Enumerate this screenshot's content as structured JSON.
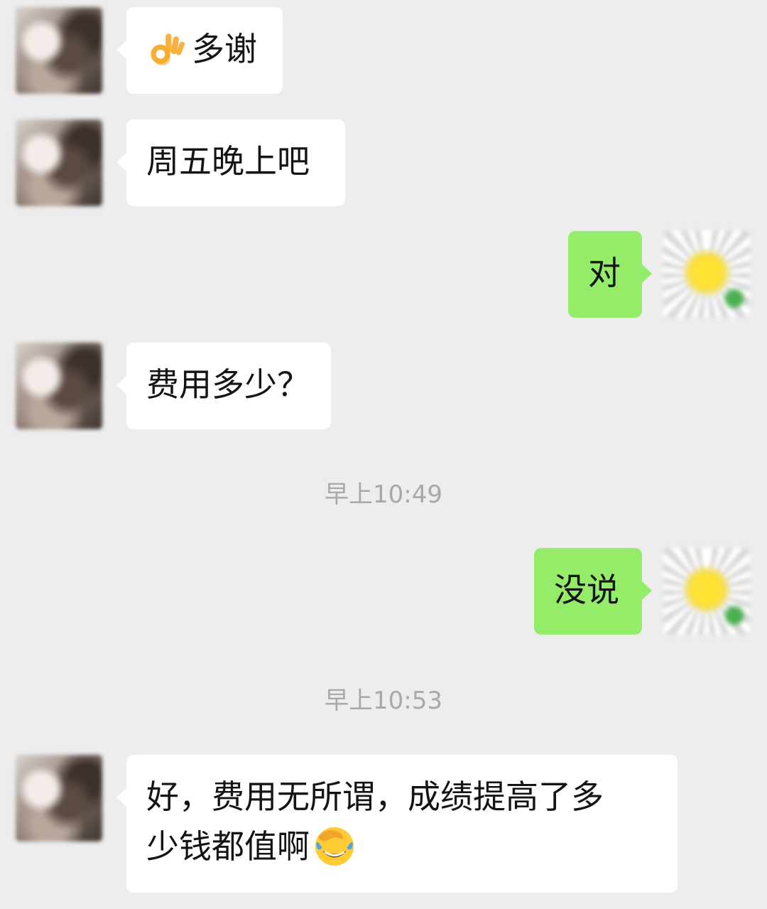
{
  "messages": [
    {
      "sender": "other",
      "text": "多谢",
      "emoji_before": "ok-hand-icon"
    },
    {
      "sender": "other",
      "text": "周五晚上吧"
    },
    {
      "sender": "self",
      "text": "对"
    },
    {
      "sender": "other",
      "text": "费用多少？"
    },
    {
      "sender": "self",
      "text": "没说"
    },
    {
      "sender": "other",
      "text_line1": "好，费用无所谓，成绩提高了多",
      "text_line2": "少钱都值啊",
      "emoji_after": "facepalm-laughing-icon"
    }
  ],
  "timestamps": [
    "早上10:49",
    "早上10:53"
  ],
  "colors": {
    "background": "#ededed",
    "other_bubble": "#ffffff",
    "self_bubble": "#95ec69",
    "timestamp_text": "#a8a8a8"
  }
}
